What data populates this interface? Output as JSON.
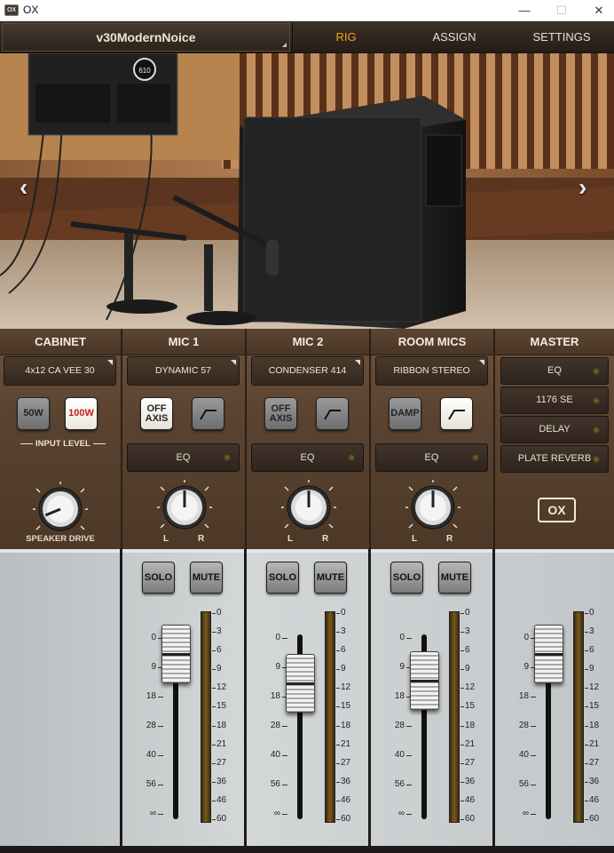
{
  "window": {
    "title": "OX",
    "icon_label": "OX",
    "minimize": "—",
    "maximize": "☐",
    "close": "✕"
  },
  "header": {
    "preset": "v30ModernNoice",
    "tabs": [
      "RIG",
      "ASSIGN",
      "SETTINGS"
    ],
    "active_tab": "RIG"
  },
  "hero": {
    "prev_arrow": "‹",
    "next_arrow": "›",
    "cabinet_badge": "610"
  },
  "channels": {
    "cabinet": {
      "title": "CABINET",
      "model": "4x12 CA VEE 30",
      "btn_50w": "50W",
      "btn_100w": "100W",
      "input_level_label": "INPUT LEVEL",
      "speaker_drive_label": "SPEAKER DRIVE",
      "speaker_drive_level": 0.25
    },
    "mic1": {
      "title": "MIC 1",
      "model": "DYNAMIC 57",
      "off_axis": "OFF AXIS",
      "eq": "EQ",
      "pan_left": "L",
      "pan_right": "R",
      "pan": 0.5
    },
    "mic2": {
      "title": "MIC 2",
      "model": "CONDENSER 414",
      "off_axis": "OFF AXIS",
      "eq": "EQ",
      "pan_left": "L",
      "pan_right": "R",
      "pan": 0.5
    },
    "room": {
      "title": "ROOM MICS",
      "model": "RIBBON STEREO",
      "damp": "DAMP",
      "eq": "EQ",
      "pan_left": "L",
      "pan_right": "R",
      "pan": 0.5
    },
    "master": {
      "title": "MASTER",
      "effects": [
        "EQ",
        "1176 SE",
        "DELAY",
        "PLATE REVERB"
      ],
      "logo": "OX"
    }
  },
  "mixer": {
    "solo": "SOLO",
    "mute": "MUTE",
    "fader_scale": [
      "0",
      "9",
      "18",
      "28",
      "40",
      "56",
      "∞"
    ],
    "meter_scale": [
      "0",
      "3",
      "6",
      "9",
      "12",
      "15",
      "18",
      "21",
      "27",
      "36",
      "46",
      "60"
    ],
    "faders": [
      {
        "name": "mic1",
        "value_db": 5
      },
      {
        "name": "mic2",
        "value_db": 14
      },
      {
        "name": "room",
        "value_db": 13
      },
      {
        "name": "master",
        "value_db": 5
      }
    ]
  },
  "colors": {
    "accent": "#f0a31e",
    "panel": "#5a4330",
    "mixer": "#c9cccd"
  }
}
